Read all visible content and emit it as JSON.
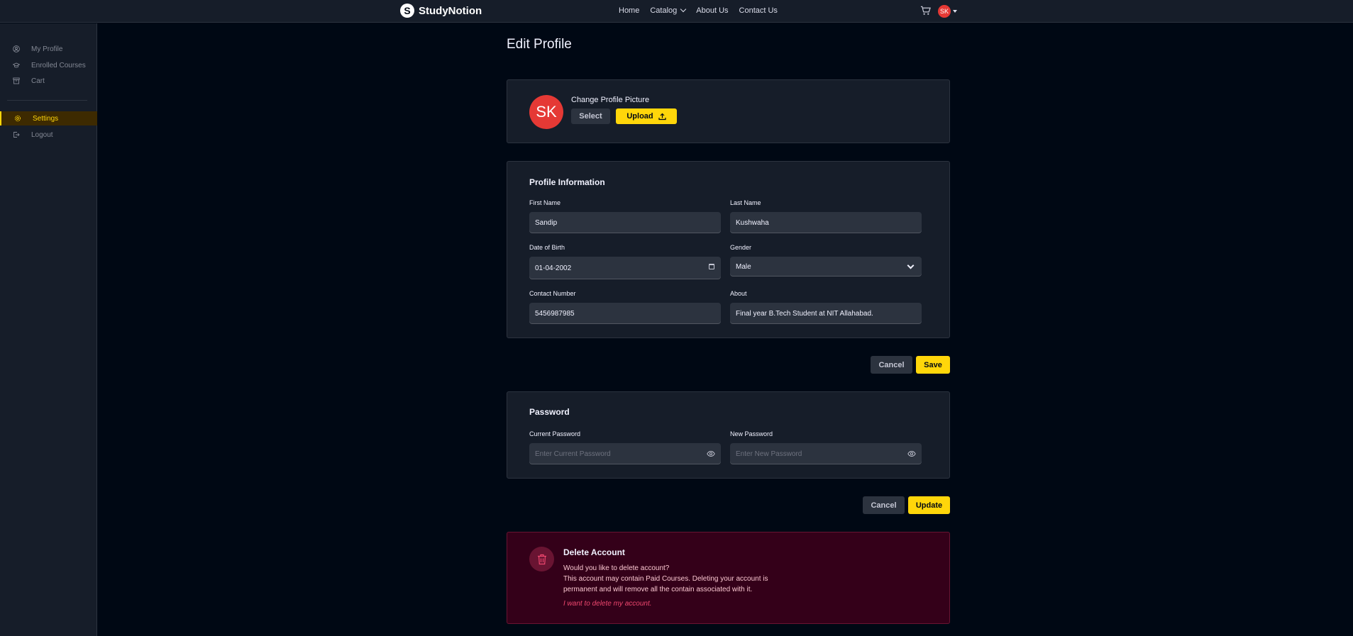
{
  "brand": {
    "name": "StudyNotion",
    "logo_letter": "S"
  },
  "nav": {
    "links": [
      "Home",
      "Catalog",
      "About Us",
      "Contact Us"
    ],
    "avatar_initials": "SK"
  },
  "sidebar": {
    "items": [
      {
        "label": "My Profile",
        "icon": "user-circle-icon"
      },
      {
        "label": "Enrolled Courses",
        "icon": "graduation-cap-icon"
      },
      {
        "label": "Cart",
        "icon": "archive-icon"
      }
    ],
    "settings_label": "Settings",
    "logout_label": "Logout"
  },
  "page": {
    "title": "Edit Profile"
  },
  "profile_picture": {
    "initials": "SK",
    "label": "Change Profile Picture",
    "select_label": "Select",
    "upload_label": "Upload"
  },
  "profile_info": {
    "title": "Profile Information",
    "first_name": {
      "label": "First Name",
      "value": "Sandip"
    },
    "last_name": {
      "label": "Last Name",
      "value": "Kushwaha"
    },
    "dob": {
      "label": "Date of Birth",
      "value": "01-04-2002"
    },
    "gender": {
      "label": "Gender",
      "value": "Male"
    },
    "contact": {
      "label": "Contact Number",
      "value": "5456987985"
    },
    "about": {
      "label": "About",
      "value": "Final year B.Tech Student at NIT Allahabad."
    },
    "cancel_label": "Cancel",
    "save_label": "Save"
  },
  "password": {
    "title": "Password",
    "current": {
      "label": "Current Password",
      "placeholder": "Enter Current Password"
    },
    "new": {
      "label": "New Password",
      "placeholder": "Enter New Password"
    },
    "cancel_label": "Cancel",
    "update_label": "Update"
  },
  "delete_account": {
    "title": "Delete Account",
    "line1": "Would you like to delete account?",
    "line2": "This account may contain Paid Courses. Deleting your account is",
    "line3": "permanent and will remove all the contain associated with it.",
    "link": "I want to delete my account."
  },
  "colors": {
    "accent": "#ffd60a",
    "danger_bg": "#340019",
    "danger_link": "#ef476f",
    "avatar": "#e53935"
  }
}
